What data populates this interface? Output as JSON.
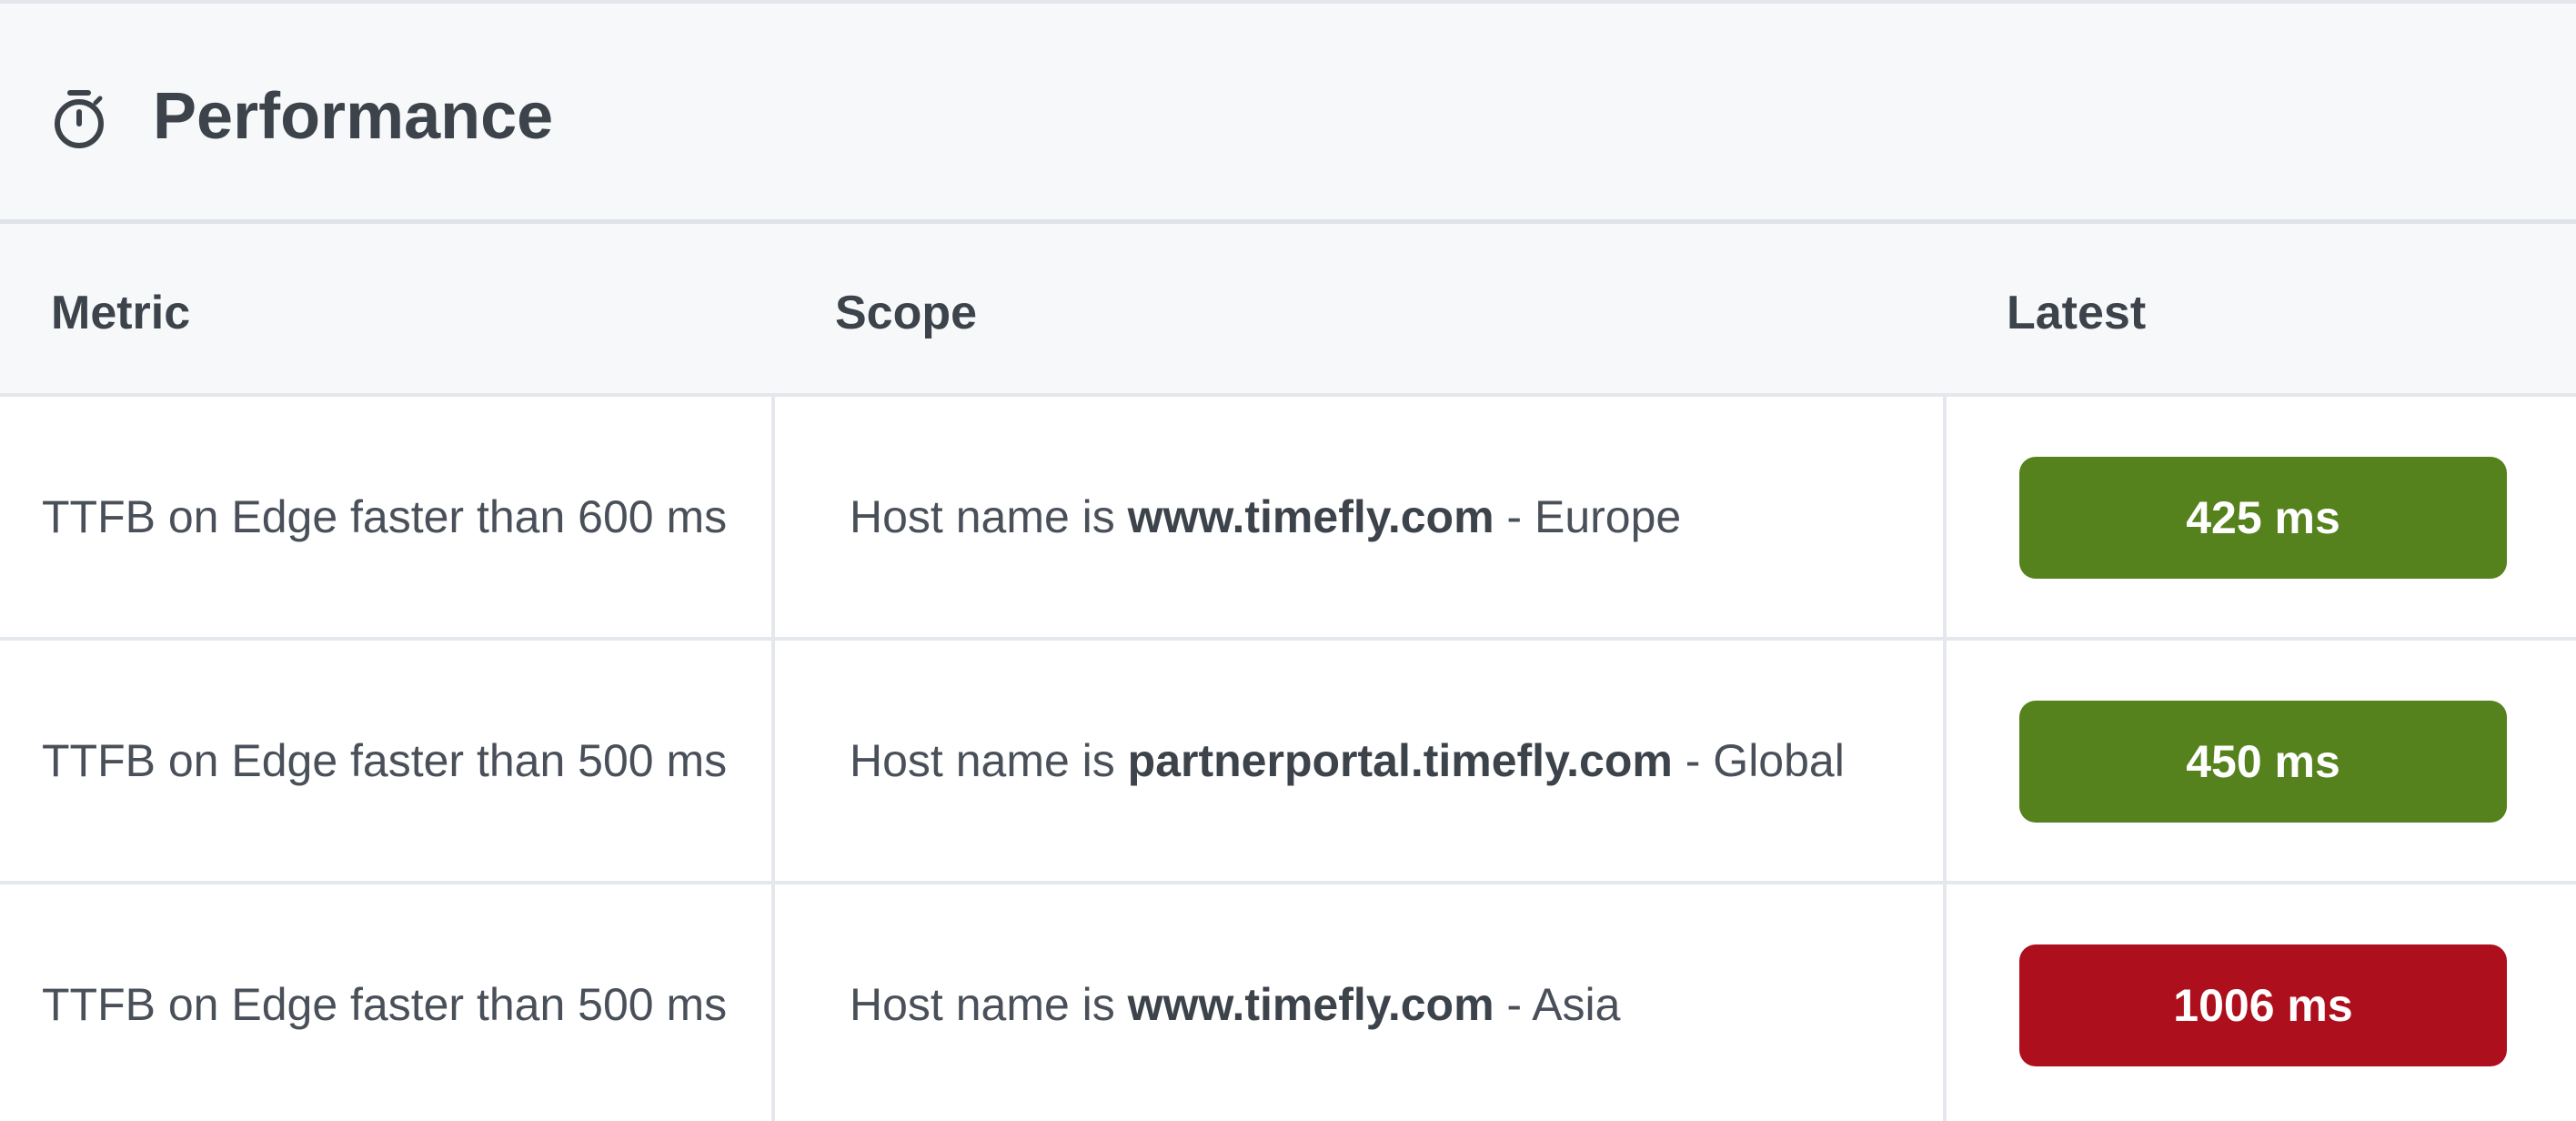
{
  "panel": {
    "title": "Performance",
    "icon": "stopwatch-icon"
  },
  "table": {
    "columns": [
      "Metric",
      "Scope",
      "Latest"
    ],
    "rows": [
      {
        "metric": "TTFB on Edge faster than 600 ms",
        "scope_prefix": "Host name is ",
        "scope_host": "www.timefly.com",
        "scope_suffix": " - Europe",
        "latest": "425 ms",
        "status": "pass",
        "status_color": "#55821c"
      },
      {
        "metric": "TTFB on Edge faster than 500 ms",
        "scope_prefix": "Host name is ",
        "scope_host": "partnerportal.timefly.com",
        "scope_suffix": " - Global",
        "latest": "450 ms",
        "status": "pass",
        "status_color": "#55821c"
      },
      {
        "metric": "TTFB on Edge faster than 500 ms",
        "scope_prefix": "Host name is ",
        "scope_host": "www.timefly.com",
        "scope_suffix": " - Asia",
        "latest": "1006 ms",
        "status": "fail",
        "status_color": "#ad0f1c"
      }
    ]
  }
}
